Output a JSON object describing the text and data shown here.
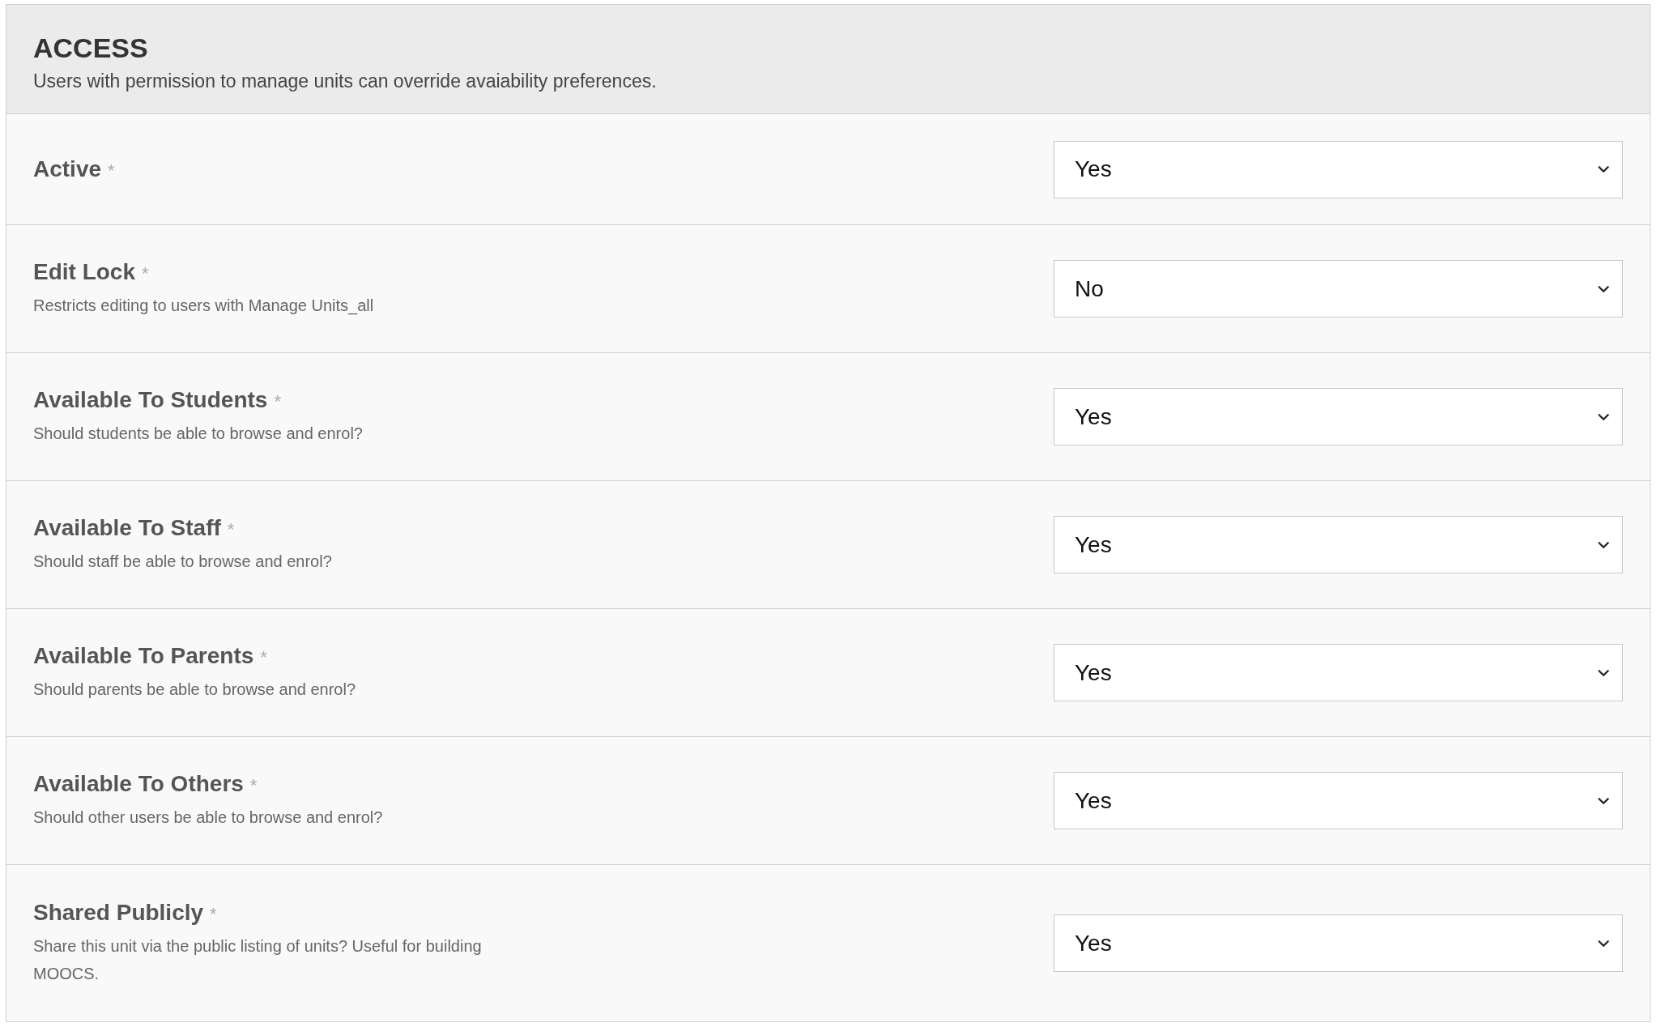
{
  "section": {
    "title": "ACCESS",
    "description": "Users with permission to manage units can override avaiability preferences."
  },
  "fields": [
    {
      "label": "Active",
      "required_mark": "*",
      "value": "Yes"
    },
    {
      "label": "Edit Lock",
      "required_mark": "*",
      "description": "Restricts editing to users with Manage Units_all",
      "value": "No"
    },
    {
      "label": "Available To Students",
      "required_mark": "*",
      "description": "Should students be able to browse and enrol?",
      "value": "Yes"
    },
    {
      "label": "Available To Staff",
      "required_mark": "*",
      "description": "Should staff be able to browse and enrol?",
      "value": "Yes"
    },
    {
      "label": "Available To Parents",
      "required_mark": "*",
      "description": "Should parents be able to browse and enrol?",
      "value": "Yes"
    },
    {
      "label": "Available To Others",
      "required_mark": "*",
      "description": "Should other users be able to browse and enrol?",
      "value": "Yes"
    },
    {
      "label": "Shared Publicly",
      "required_mark": "*",
      "description": "Share this unit via the public listing of units? Useful for building MOOCS.",
      "value": "Yes"
    }
  ]
}
